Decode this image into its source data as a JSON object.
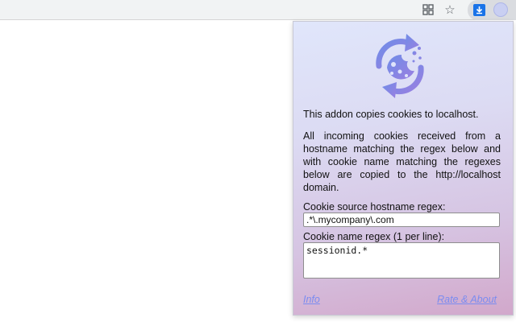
{
  "browser_toolbar": {
    "icons": [
      "extensions-grid-icon",
      "bookmark-star-icon",
      "download-extension-icon",
      "cookie-extension-icon"
    ]
  },
  "popup": {
    "logo_icon": "cookie-sync-icon",
    "intro": "This addon copies cookies to localhost.",
    "description": "All incoming cookies received from a hostname matching the regex below and with cookie name matching the regexes below are copied to the http://localhost domain.",
    "source_label": "Cookie source hostname regex:",
    "source_value": ".*\\.mycompany\\.com",
    "name_label": "Cookie name regex (1 per line):",
    "name_value": "sessionid.*",
    "info_link": "Info",
    "rate_link": "Rate & About"
  },
  "colors": {
    "accent": "#7b8cf0",
    "logo_gradient_start": "#6f8de8",
    "logo_gradient_end": "#9a7fe0"
  }
}
